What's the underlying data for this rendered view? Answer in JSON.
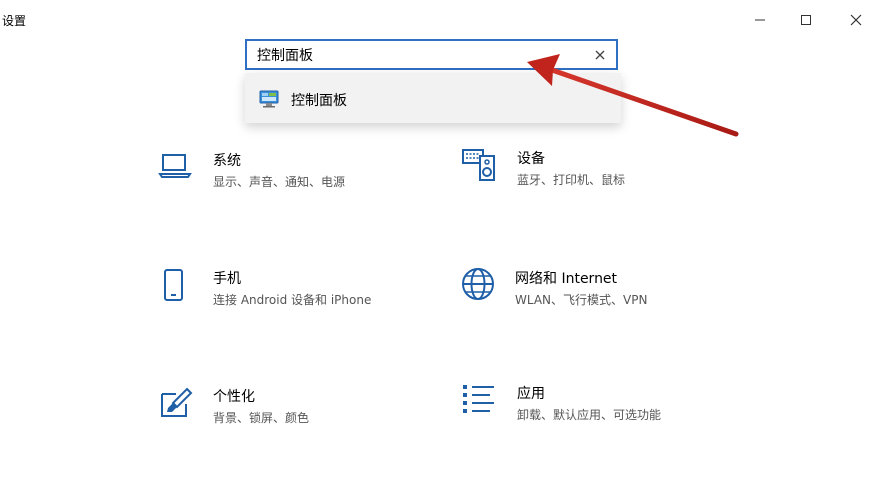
{
  "window": {
    "title": "设置",
    "controls": [
      "minimize",
      "maximize",
      "close"
    ]
  },
  "search": {
    "value": "控制面板",
    "placeholder": "",
    "suggestion": "控制面板"
  },
  "categories": [
    {
      "title": "系统",
      "subtitle": "显示、声音、通知、电源",
      "icon": "laptop-icon"
    },
    {
      "title": "设备",
      "subtitle": "蓝牙、打印机、鼠标",
      "icon": "keyboard-speaker-icon"
    },
    {
      "title": "手机",
      "subtitle": "连接 Android 设备和 iPhone",
      "icon": "phone-icon"
    },
    {
      "title": "网络和 Internet",
      "subtitle": "WLAN、飞行模式、VPN",
      "icon": "globe-icon"
    },
    {
      "title": "个性化",
      "subtitle": "背景、锁屏、颜色",
      "icon": "paint-brush-icon"
    },
    {
      "title": "应用",
      "subtitle": "卸载、默认应用、可选功能",
      "icon": "app-list-icon"
    }
  ],
  "colors": {
    "accent": "#2f6fc4",
    "icon_blue": "#1f5fa8",
    "annotation_arrow": "#c0241c"
  }
}
